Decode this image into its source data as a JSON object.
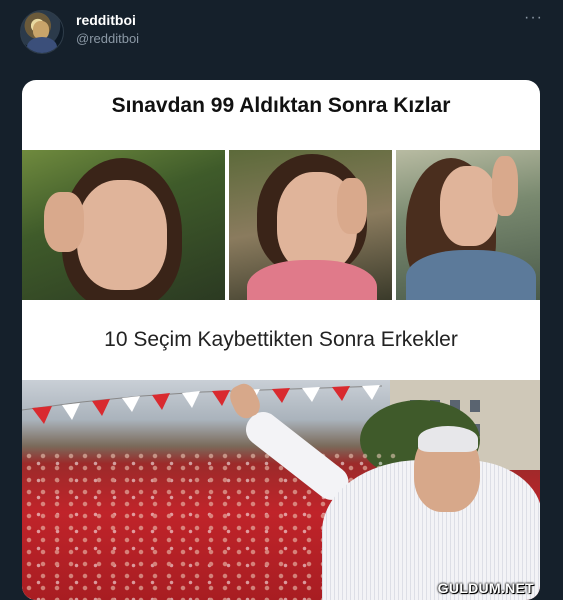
{
  "tweet": {
    "display_name": "redditboi",
    "handle": "@redditboi",
    "more_icon": "more-horizontal-icon",
    "more_label": "···"
  },
  "meme": {
    "caption_top": "Sınavdan 99 Aldıktan Sonra Kızlar",
    "caption_bottom": "10 Seçim Kaybettikten Sonra Erkekler",
    "watermark": "GULDUM.NET"
  },
  "colors": {
    "background": "#15202b",
    "text_primary": "#ffffff",
    "text_secondary": "#8b98a5"
  }
}
